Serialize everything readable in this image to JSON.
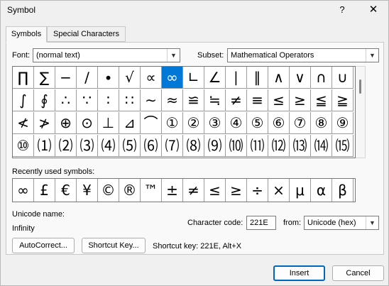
{
  "window": {
    "title": "Symbol",
    "help_glyph": "?",
    "close_glyph": "✕"
  },
  "tabs": [
    {
      "label": "Symbols",
      "active": true
    },
    {
      "label": "Special Characters",
      "active": false
    }
  ],
  "font": {
    "label": "Font:",
    "value": "(normal text)"
  },
  "subset": {
    "label": "Subset:",
    "value": "Mathematical Operators"
  },
  "grid": {
    "selected_index": 7,
    "rows": [
      [
        "∏",
        "∑",
        "−",
        "∕",
        "∙",
        "√",
        "∝",
        "∞",
        "∟",
        "∠",
        "∣",
        "∥",
        "∧",
        "∨",
        "∩",
        "∪"
      ],
      [
        "∫",
        "∮",
        "∴",
        "∵",
        "∶",
        "∷",
        "∼",
        "≈",
        "≌",
        "≒",
        "≠",
        "≡",
        "≤",
        "≥",
        "≦",
        "≧"
      ],
      [
        "≮",
        "≯",
        "⊕",
        "⊙",
        "⊥",
        "⊿",
        "⌒",
        "①",
        "②",
        "③",
        "④",
        "⑤",
        "⑥",
        "⑦",
        "⑧",
        "⑨"
      ],
      [
        "⑩",
        "⑴",
        "⑵",
        "⑶",
        "⑷",
        "⑸",
        "⑹",
        "⑺",
        "⑻",
        "⑼",
        "⑽",
        "⑾",
        "⑿",
        "⒀",
        "⒁",
        "⒂"
      ]
    ]
  },
  "recent": {
    "label": "Recently used symbols:",
    "symbols": [
      "∞",
      "£",
      "€",
      "¥",
      "©",
      "®",
      "™",
      "±",
      "≠",
      "≤",
      "≥",
      "÷",
      "×",
      "μ",
      "α",
      "β"
    ]
  },
  "unicode_name": {
    "label": "Unicode name:",
    "value": "Infinity"
  },
  "char_code": {
    "label": "Character code:",
    "value": "221E"
  },
  "from": {
    "label": "from:",
    "value": "Unicode (hex)"
  },
  "buttons": {
    "autocorrect": "AutoCorrect...",
    "shortcut_key": "Shortcut Key...",
    "insert": "Insert",
    "cancel": "Cancel"
  },
  "shortcut_text": "Shortcut key: 221E, Alt+X",
  "colors": {
    "selection": "#0078d7",
    "default_button_border": "#0067c0"
  }
}
